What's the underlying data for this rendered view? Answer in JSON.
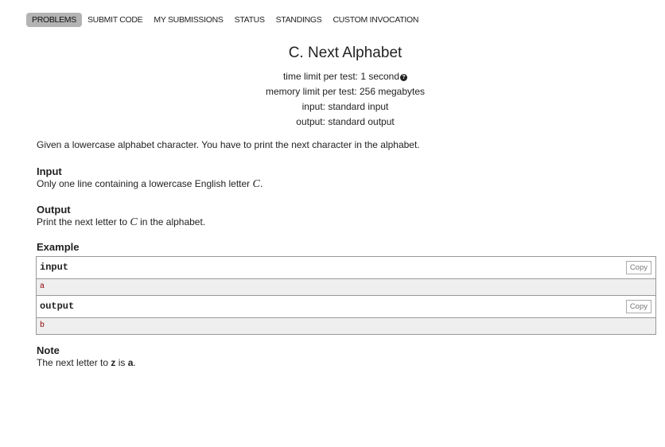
{
  "nav": {
    "items": [
      "PROBLEMS",
      "SUBMIT CODE",
      "MY SUBMISSIONS",
      "STATUS",
      "STANDINGS",
      "CUSTOM INVOCATION"
    ],
    "active_index": 0
  },
  "problem": {
    "title": "C. Next Alphabet",
    "time_limit": "time limit per test: 1 second",
    "memory_limit": "memory limit per test: 256 megabytes",
    "input_file": "input: standard input",
    "output_file": "output: standard output",
    "legend": "Given a lowercase alphabet character. You have to print the next character in the alphabet."
  },
  "input_section": {
    "title": "Input",
    "text_before": "Only one line containing a lowercase English letter ",
    "math": "C",
    "text_after": "."
  },
  "output_section": {
    "title": "Output",
    "text_before": "Print the next letter to ",
    "math": "C",
    "text_after": " in the alphabet."
  },
  "example": {
    "title": "Example",
    "input_label": "input",
    "input_value": "a",
    "output_label": "output",
    "output_value": "b",
    "copy_label": "Copy"
  },
  "note": {
    "title": "Note",
    "text1": "The next letter to ",
    "bold1": "z",
    "text2": " is ",
    "bold2": "a",
    "text3": "."
  },
  "colors": {
    "nav_active_bg": "#b3b3b3",
    "sample_text": "#8b0000",
    "sample_bg": "#efefef"
  }
}
